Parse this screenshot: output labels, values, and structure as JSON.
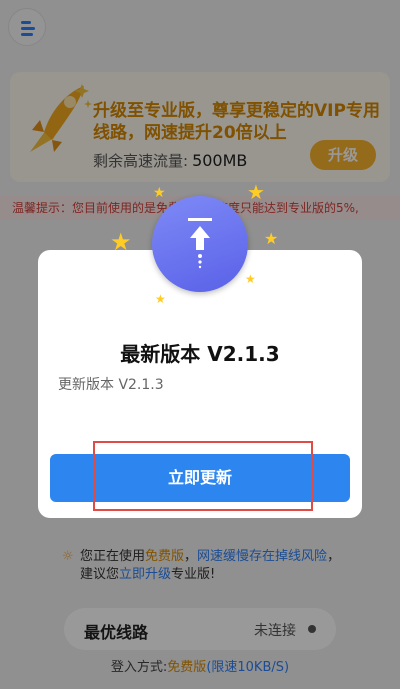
{
  "app": {
    "promo": {
      "title": "升级至专业版，尊享更稳定的VIP专用线路，网速提升20倍以上",
      "traffic_label": "剩余高速流量:",
      "traffic_value": "500MB",
      "upgrade_label": "升级"
    },
    "tip_bar": "温馨提示：您目前使用的是免费版，网速度只能达到专业版的5%,",
    "notice": {
      "prefix": "您正在使用",
      "free": "免费版",
      "risk": "网速缓慢存在掉线风险",
      "line2_prefix": "建议您",
      "upgrade_link": "立即升级",
      "line2_suffix": "专业版!"
    },
    "route": {
      "label": "最优线路",
      "status": "未连接"
    },
    "login_mode": {
      "label": "登入方式:",
      "free": "免费版",
      "speed": "(限速10KB/S)"
    }
  },
  "modal": {
    "title": "最新版本 V2.1.3",
    "body": "更新版本 V2.1.3",
    "update_button": "立即更新"
  },
  "colors": {
    "primary": "#2d86f0",
    "accent": "#f7b12e",
    "warning": "#d0403a",
    "highlight": "#e14b46"
  },
  "icons": [
    "menu-icon",
    "rocket-icon",
    "upload-icon",
    "star-icon",
    "lightbulb-icon",
    "status-dot-icon"
  ]
}
